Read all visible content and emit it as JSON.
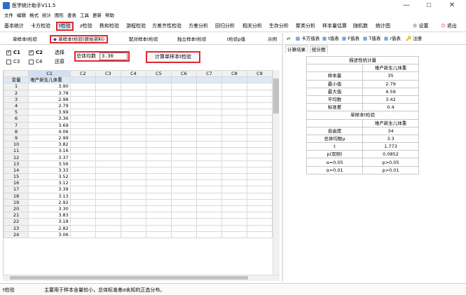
{
  "window": {
    "title": "医学统计助手V11.5",
    "controls": {
      "minimize": "—",
      "maximize": "☐",
      "close": "✕"
    }
  },
  "menu": [
    "文件",
    "编辑",
    "格式",
    "统计",
    "图形",
    "查表",
    "工具",
    "更新",
    "帮助"
  ],
  "toolbar": {
    "items": [
      "基本统计",
      "卡方检验",
      "t检验",
      "z检验",
      "秩和检验",
      "游程检验",
      "方差齐性检验",
      "方差分析",
      "回归分析",
      "相关分析",
      "生存分析",
      "聚类分析",
      "样本量估算",
      "随机数",
      "统计图"
    ],
    "active": "t检验",
    "settings": "设置",
    "exit": "退出"
  },
  "subtabs": {
    "items": [
      "单样本t检验",
      "单样本t检验(原始资料)",
      "配对样本t检验",
      "独立样本t检验",
      "t检验p值",
      "示例"
    ],
    "active": "单样本t检验(原始资料)"
  },
  "controls": {
    "checkboxes": [
      {
        "label": "C1",
        "checked": true
      },
      {
        "label": "C2",
        "checked": true
      },
      {
        "label": "C3",
        "checked": false
      },
      {
        "label": "C4",
        "checked": false
      }
    ],
    "select_label": "选择",
    "restore_label": "还原",
    "mean_label": "总体均数",
    "mean_value": "3.30",
    "calc_button": "计算单样本t检验"
  },
  "sheet": {
    "columns": [
      "C1",
      "C2",
      "C3",
      "C4",
      "C5",
      "C6",
      "C7",
      "C8",
      "C9"
    ],
    "variable_row_label": "变量",
    "variable_name": "难产新生儿体重",
    "rows": [
      [
        "1",
        "3.90"
      ],
      [
        "2",
        "3.78"
      ],
      [
        "3",
        "2.98"
      ],
      [
        "4",
        "2.79"
      ],
      [
        "5",
        "3.99"
      ],
      [
        "6",
        "3.36"
      ],
      [
        "7",
        "3.69"
      ],
      [
        "8",
        "4.06"
      ],
      [
        "9",
        "2.99"
      ],
      [
        "10",
        "3.82"
      ],
      [
        "11",
        "3.16"
      ],
      [
        "12",
        "3.37"
      ],
      [
        "13",
        "3.56"
      ],
      [
        "14",
        "3.33"
      ],
      [
        "15",
        "3.52"
      ],
      [
        "16",
        "3.12"
      ],
      [
        "17",
        "3.39"
      ],
      [
        "18",
        "3.13"
      ],
      [
        "19",
        "2.92"
      ],
      [
        "20",
        "3.30"
      ],
      [
        "21",
        "3.83"
      ],
      [
        "22",
        "3.18"
      ],
      [
        "23",
        "2.82"
      ],
      [
        "24",
        "3.06"
      ]
    ]
  },
  "right_toolbar": {
    "items": [
      "卡方值表",
      "t值表",
      "F值表",
      "T值表",
      "r值表",
      "注册"
    ]
  },
  "result_tabs": {
    "items": [
      "计算结果",
      "统计图"
    ],
    "active": "计算结果"
  },
  "results": {
    "section1_title": "描述性统计量",
    "section1_header": "难产新生儿体重",
    "section1_rows": [
      [
        "样本量",
        "35"
      ],
      [
        "最小值",
        "2.79"
      ],
      [
        "最大值",
        "4.59"
      ],
      [
        "平均数",
        "3.42"
      ],
      [
        "标准差",
        "0.4"
      ]
    ],
    "section2_title": "单样本t检验",
    "section2_header": "难产新生儿体重",
    "section2_rows": [
      [
        "自由度",
        "34"
      ],
      [
        "总体均数μ",
        "3.3"
      ],
      [
        "t",
        "1.773"
      ],
      [
        "p(双侧)",
        "0.0852"
      ],
      [
        "α=0.05",
        "p>0.05"
      ],
      [
        "α=0.01",
        "p>0.01"
      ]
    ]
  },
  "status": {
    "left": "t检验",
    "message": "主要用于样本含量较小，总体标准差σ未知的正态分布。"
  },
  "colors": {
    "highlight_red": "#e0282e",
    "selection_blue": "#dde9f7"
  }
}
